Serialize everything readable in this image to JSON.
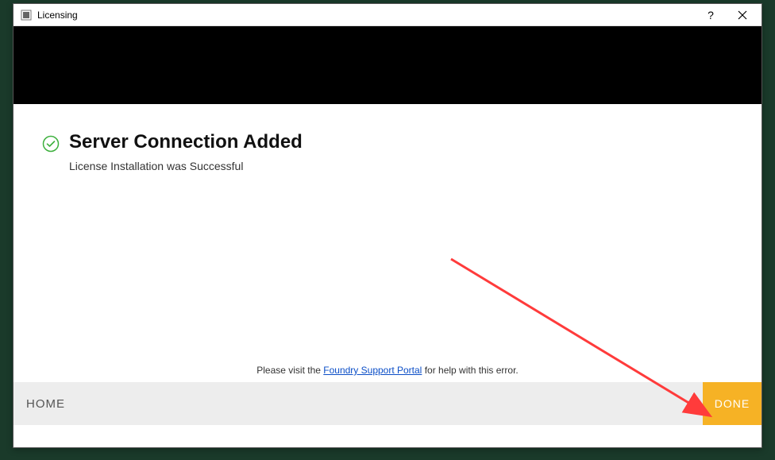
{
  "window": {
    "title": "Licensing"
  },
  "content": {
    "heading": "Server Connection Added",
    "subtext": "License Installation was Successful",
    "help_prefix": "Please visit the ",
    "help_link": "Foundry Support Portal",
    "help_suffix": " for help with this error."
  },
  "footer": {
    "home_label": "HOME",
    "done_label": "DONE"
  },
  "colors": {
    "accent": "#f6b225",
    "success": "#3db03d",
    "link": "#0b4ec7"
  }
}
